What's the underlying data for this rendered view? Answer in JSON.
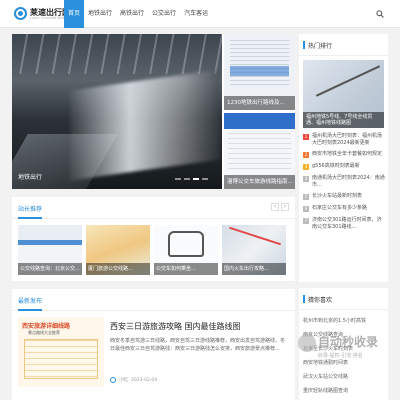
{
  "header": {
    "logo_title": "莱速出行网",
    "logo_sub": "LAISU CHUXING WANG",
    "nav": [
      "首页",
      "地铁出行",
      "高铁出行",
      "公交出行",
      "汽车客运"
    ],
    "active_index": 0
  },
  "hero": {
    "main_caption": "地铁出行",
    "thumb1_caption": "1230地铁出行路线及...",
    "thumb2_caption": "淄博公交车旅游线路指南..."
  },
  "sidebar": {
    "hot_title": "热门排行",
    "hot_image_caption": "福州地铁5号线、7号线全线贯通、福州地铁线路图",
    "hot_items": [
      {
        "rank": "1",
        "text": "福州机场大巴时刻表：福州机场大巴时刻表2024最新更新"
      },
      {
        "rank": "2",
        "text": "西安市地铁全年卡套餐如何规定"
      },
      {
        "rank": "3",
        "text": "g556高铁时刻表最新"
      },
      {
        "rank": "4",
        "text": "南通机场大巴时刻表2024：南通市..."
      },
      {
        "rank": "5",
        "text": "长沙火车站最新时刻表"
      },
      {
        "rank": "6",
        "text": "石家庄公交车有多少条路"
      },
      {
        "rank": "7",
        "text": "济南公交301路运行时间表，济南公交车301路线..."
      }
    ],
    "tags_title": "猜你喜欢",
    "tags": [
      "杭州市到北京的1.5小时高铁",
      "南京公交线路查询",
      "北京至长沙火车时刻表",
      "西安地铁通勤时间表",
      "武汉火车站公交线路",
      "重庆轻轨线路图查询",
      "成都公交卡办理指南"
    ]
  },
  "recommend": {
    "title": "站长推荐",
    "cards": [
      "公交线路查询：北京公交...",
      "厦门旅游公交线路...",
      "公交车如何乘坐...",
      "国内火车出行攻略..."
    ]
  },
  "latest": {
    "title": "最新发布",
    "image_title": "西安旅游详细线路",
    "image_sub": "景点路线大全推荐",
    "post_title": "西安三日游旅游攻略 国内最佳路线图",
    "post_excerpt": "西安冬季自驾游三日线路，西安自驾三日游线路推荐，西安出发自驾游路线，冬日最佳西安三日自驾游路线：西安三日游路线怎么安排，西安旅游景点推荐...",
    "post_author": "小吃",
    "post_date": "2023-02-04"
  },
  "watermark": {
    "text": "自动秒收录",
    "sub": "收录·提权·引流·排名"
  }
}
